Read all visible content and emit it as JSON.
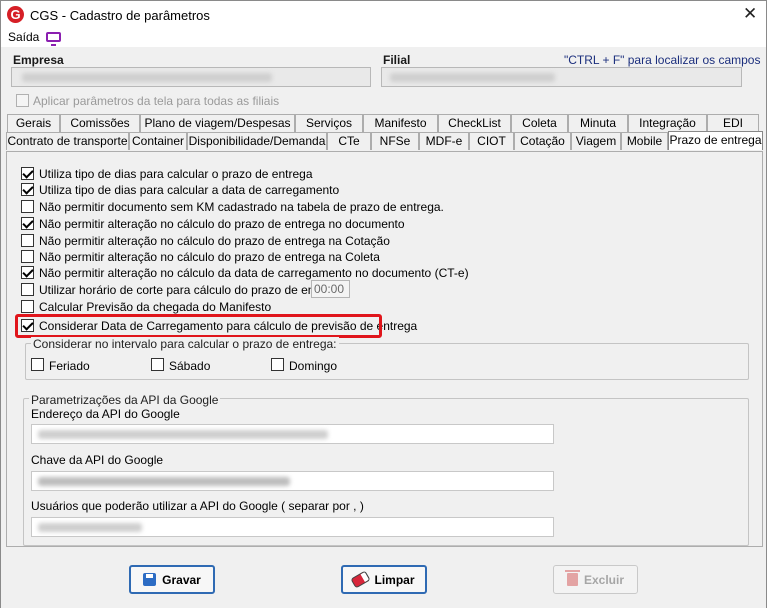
{
  "window": {
    "title": "CGS - Cadastro de parâmetros",
    "close_glyph": "✕"
  },
  "menu": {
    "saida_label": "Saída",
    "monitor_icon": "monitor-icon"
  },
  "header": {
    "empresa_label": "Empresa",
    "filial_label": "Filial",
    "search_hint": "\"CTRL + F\" para localizar os campos",
    "apply_all_label": "Aplicar parâmetros da tela para todas as filiais",
    "apply_all_checked": false
  },
  "tabs_row1": [
    "Gerais",
    "Comissões",
    "Plano de viagem/Despesas",
    "Serviços",
    "Manifesto",
    "CheckList",
    "Coleta",
    "Minuta",
    "Integração",
    "EDI"
  ],
  "tabs_row2": [
    "Contrato de transporte",
    "Container",
    "Disponibilidade/Demanda",
    "CTe",
    "NFSe",
    "MDF-e",
    "CIOT",
    "Cotação",
    "Viagem",
    "Mobile",
    "Prazo de entrega"
  ],
  "active_tab": "Prazo de entrega",
  "options": [
    {
      "label": "Utiliza tipo de dias para calcular o prazo de entrega",
      "checked": true
    },
    {
      "label": "Utiliza tipo de dias para calcular a data de carregamento",
      "checked": true
    },
    {
      "label": "Não permitir documento sem KM cadastrado na tabela de prazo de entrega.",
      "checked": false
    },
    {
      "label": "Não permitir alteração no cálculo do prazo de entrega no documento",
      "checked": true
    },
    {
      "label": "Não permitir alteração no cálculo do prazo de entrega na Cotação",
      "checked": false
    },
    {
      "label": "Não permitir alteração no cálculo do prazo de entrega na Coleta",
      "checked": false
    },
    {
      "label": "Não permitir alteração no cálculo da data de carregamento no documento (CT-e)",
      "checked": true
    },
    {
      "label": "Utilizar horário de corte para cálculo do prazo de entrega",
      "checked": false
    },
    {
      "label": "Calcular Previsão da chegada do Manifesto",
      "checked": false
    },
    {
      "label": "Considerar Data de Carregamento para cálculo de previsão de entrega",
      "checked": true
    }
  ],
  "cutoff_time_value": "00:00",
  "interval_group": {
    "title": "Considerar no intervalo para calcular o prazo de entrega:",
    "feriado": "Feriado",
    "sabado": "Sábado",
    "domingo": "Domingo"
  },
  "google_group": {
    "title": "Parametrizações da API da Google",
    "endereco_label": "Endereço da API do Google",
    "chave_label": "Chave da API do Google",
    "usuarios_label": "Usuários que poderão utilizar a API do Google ( separar por , )"
  },
  "footer": {
    "gravar": "Gravar",
    "limpar": "Limpar",
    "excluir": "Excluir"
  },
  "colors": {
    "highlight": "#e0151b",
    "button_border": "#2f6ab3",
    "hint_text": "#1c2f7d"
  }
}
